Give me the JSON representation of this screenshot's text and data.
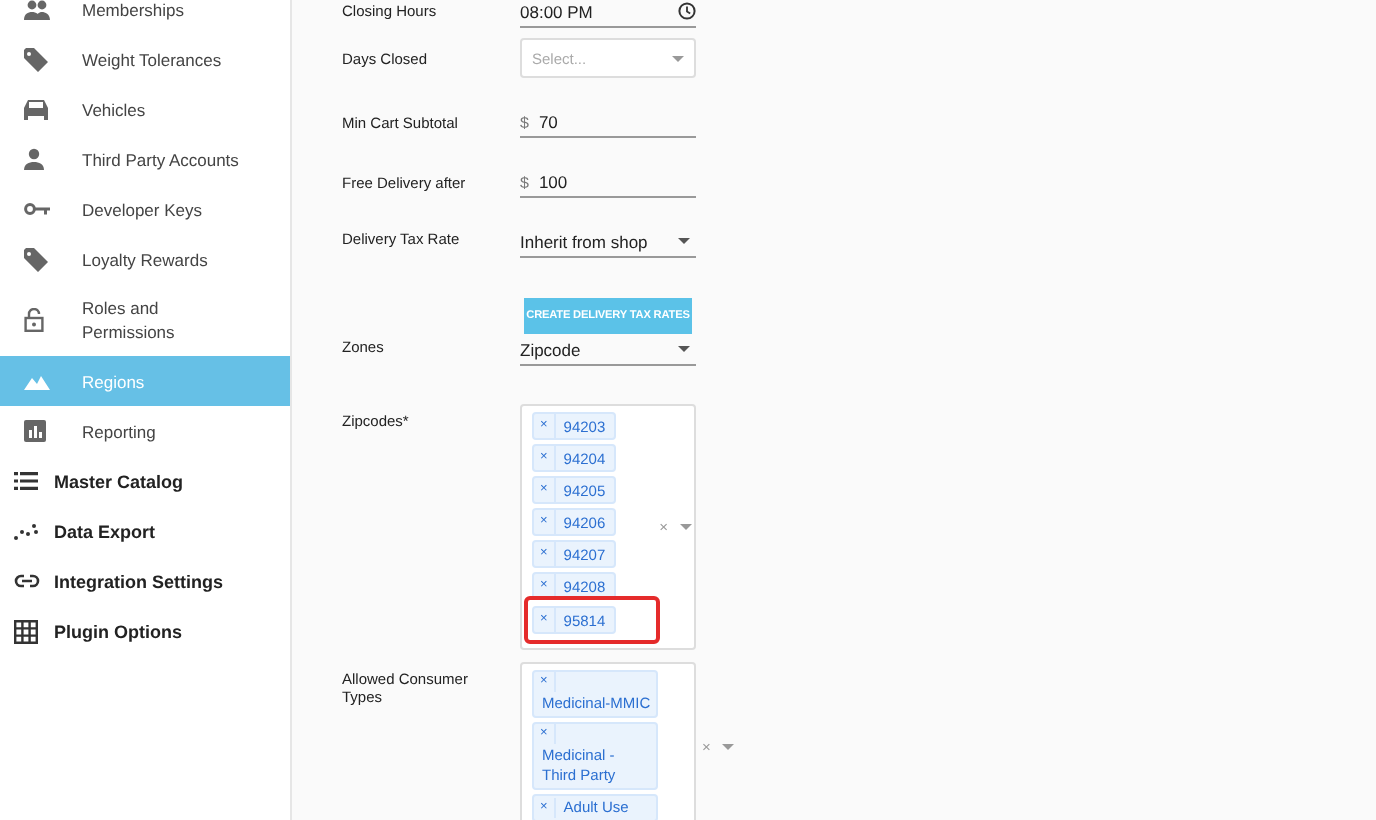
{
  "sidebar": {
    "items": [
      {
        "label": "Memberships",
        "kind": "sub",
        "selected": false
      },
      {
        "label": "Weight Tolerances",
        "kind": "sub",
        "selected": false
      },
      {
        "label": "Vehicles",
        "kind": "sub",
        "selected": false
      },
      {
        "label": "Third Party Accounts",
        "kind": "sub",
        "selected": false
      },
      {
        "label": "Developer Keys",
        "kind": "sub",
        "selected": false
      },
      {
        "label": "Loyalty Rewards",
        "kind": "sub",
        "selected": false
      },
      {
        "label": "Roles and Permissions",
        "kind": "sub",
        "selected": false
      },
      {
        "label": "Regions",
        "kind": "sub",
        "selected": true
      },
      {
        "label": "Reporting",
        "kind": "sub",
        "selected": false
      },
      {
        "label": "Master Catalog",
        "kind": "top",
        "selected": false
      },
      {
        "label": "Data Export",
        "kind": "top",
        "selected": false
      },
      {
        "label": "Integration Settings",
        "kind": "top",
        "selected": false
      },
      {
        "label": "Plugin Options",
        "kind": "top",
        "selected": false
      }
    ]
  },
  "form": {
    "fields": [
      {
        "label": "Closing Hours",
        "kind": "time",
        "value": "08:00 PM"
      },
      {
        "label": "Days Closed",
        "kind": "multiselect",
        "placeholder": "Select..."
      },
      {
        "label": "Min Cart Subtotal",
        "kind": "money",
        "prefix": "$",
        "value": "70"
      },
      {
        "label": "Free Delivery after",
        "kind": "money",
        "prefix": "$",
        "value": "100"
      },
      {
        "label": "Delivery Tax Rate",
        "kind": "dropdown",
        "value": "Inherit from shop"
      },
      {
        "kind": "button",
        "value": "CREATE DELIVERY TAX RATES"
      },
      {
        "label": "Zones",
        "kind": "dropdown",
        "value": "Zipcode"
      },
      {
        "label": "Zipcodes*",
        "kind": "tags",
        "remove": "×",
        "clear": "×",
        "tags": [
          {
            "text": "94203",
            "highlighted": false
          },
          {
            "text": "94204",
            "highlighted": false
          },
          {
            "text": "94205",
            "highlighted": false
          },
          {
            "text": "94206",
            "highlighted": false
          },
          {
            "text": "94207",
            "highlighted": false
          },
          {
            "text": "94208",
            "highlighted": false
          },
          {
            "text": "95814",
            "highlighted": true
          }
        ]
      },
      {
        "label": "Allowed Consumer Types",
        "kind": "tags",
        "remove": "×",
        "clear": "×",
        "tags": [
          {
            "text": "Medicinal-MMIC",
            "highlighted": false
          },
          {
            "text": "Medicinal - Third Party",
            "highlighted": false
          },
          {
            "text": "Adult Use",
            "highlighted": false
          }
        ]
      }
    ]
  }
}
